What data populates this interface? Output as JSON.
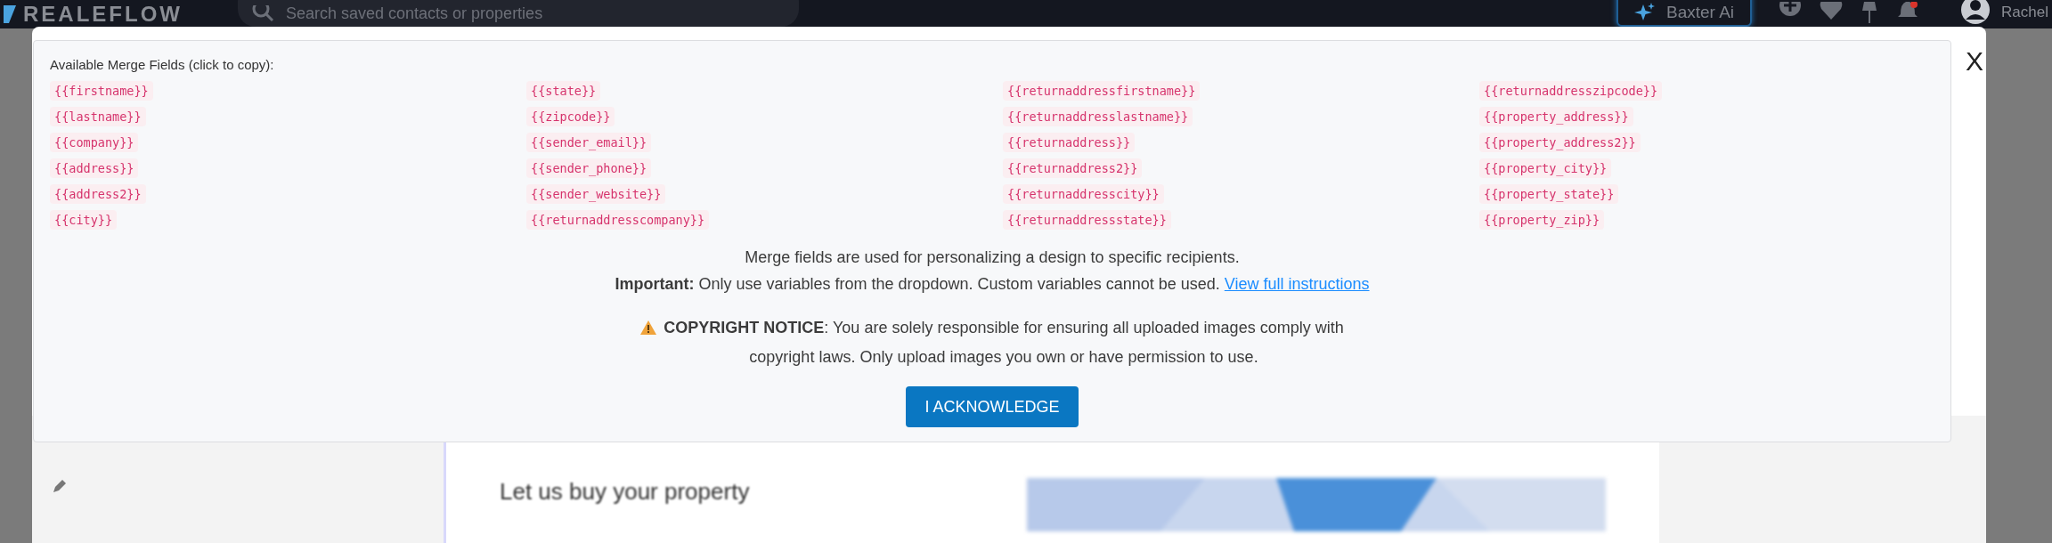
{
  "top_bar": {
    "logo": "REALEFLOW",
    "search": {
      "placeholder": "Search saved contacts or properties"
    },
    "assistant_button": "Baxter Ai",
    "notifications_unread": true,
    "user_name": "Rachel"
  },
  "modal": {
    "heading": "Available Merge Fields (click to copy):",
    "merge_field_columns": [
      [
        "{{firstname}}",
        "{{lastname}}",
        "{{company}}",
        "{{address}}",
        "{{address2}}",
        "{{city}}"
      ],
      [
        "{{state}}",
        "{{zipcode}}",
        "{{sender_email}}",
        "{{sender_phone}}",
        "{{sender_website}}",
        "{{returnaddresscompany}}"
      ],
      [
        "{{returnaddressfirstname}}",
        "{{returnaddresslastname}}",
        "{{returnaddress}}",
        "{{returnaddress2}}",
        "{{returnaddresscity}}",
        "{{returnaddressstate}}"
      ],
      [
        "{{returnaddresszipcode}}",
        "{{property_address}}",
        "{{property_address2}}",
        "{{property_city}}",
        "{{property_state}}",
        "{{property_zip}}"
      ]
    ],
    "intro": "Merge fields are used for personalizing a design to specific recipients.",
    "important": "**Important:** Only use variables from the dropdown. Custom variables cannot be used.",
    "instructions_link": "View full instructions",
    "copyright": "**COPYRIGHT NOTICE**: You are solely responsible for ensuring all uploaded images comply with copyright laws. Only upload images you own or have permission to use.",
    "acknowledge_button": "I ACKNOWLEDGE",
    "close_button": "X"
  },
  "background_page": {
    "headline": "Let us buy your property"
  }
}
